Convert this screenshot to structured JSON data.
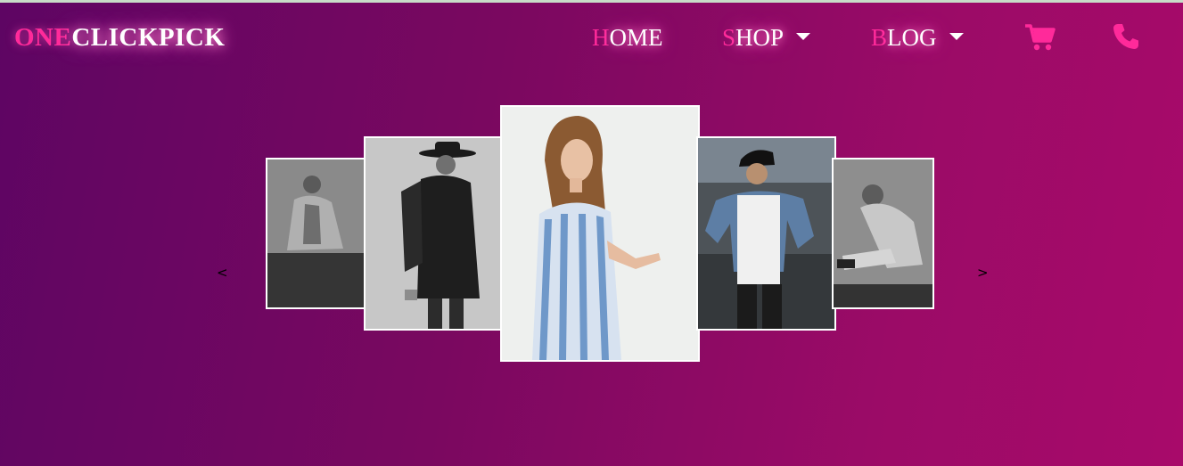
{
  "brand": {
    "part1": "ONE",
    "part2": "CLICKPICK"
  },
  "nav": {
    "home": {
      "first": "H",
      "rest": "OME"
    },
    "shop": {
      "first": "S",
      "rest": "HOP"
    },
    "blog": {
      "first": "B",
      "rest": "LOG"
    }
  },
  "icons": {
    "cart": "shopping-cart-icon",
    "phone": "phone-icon"
  },
  "carousel": {
    "prev": "<",
    "next": ">"
  },
  "colors": {
    "accent": "#ff2a9a",
    "bg_start": "#5e0563",
    "bg_end": "#a80a6a"
  }
}
